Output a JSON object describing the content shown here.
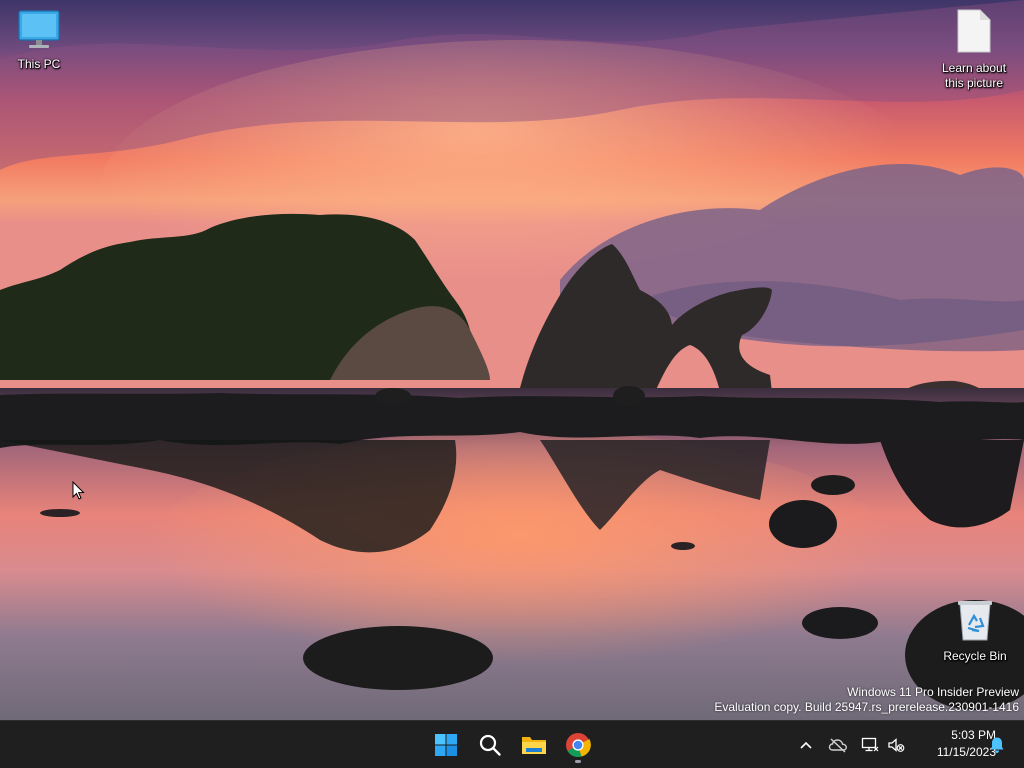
{
  "desktop": {
    "icons": {
      "this_pc": {
        "label": "This PC",
        "icon": "monitor-icon"
      },
      "learn_picture": {
        "label_line1": "Learn about",
        "label_line2": "this picture",
        "icon": "document-icon"
      },
      "recycle_bin": {
        "label": "Recycle Bin",
        "icon": "recycle-bin-icon"
      }
    },
    "watermark": {
      "line1": "Windows 11 Pro Insider Preview",
      "line2": "Evaluation copy. Build 25947.rs_prerelease.230901-1416"
    }
  },
  "taskbar": {
    "pinned": [
      {
        "name": "start",
        "icon": "windows-logo-icon"
      },
      {
        "name": "search",
        "icon": "search-icon"
      },
      {
        "name": "file-explorer",
        "icon": "folder-icon"
      },
      {
        "name": "chrome",
        "icon": "chrome-icon",
        "running": true
      }
    ],
    "tray": {
      "overflow_icon": "chevron-up-icon",
      "onedrive_icon": "cloud-offline-icon",
      "network_icon": "network-disconnected-icon",
      "volume_icon": "volume-muted-icon",
      "notification_icon": "bell-icon"
    },
    "clock": {
      "time": "5:03 PM",
      "date": "11/15/2023"
    }
  },
  "colors": {
    "taskbar": "#1f1f1f",
    "accent": "#0078d4",
    "sky_top": "#4a3a6e",
    "sky_glow": "#f07a5a"
  }
}
